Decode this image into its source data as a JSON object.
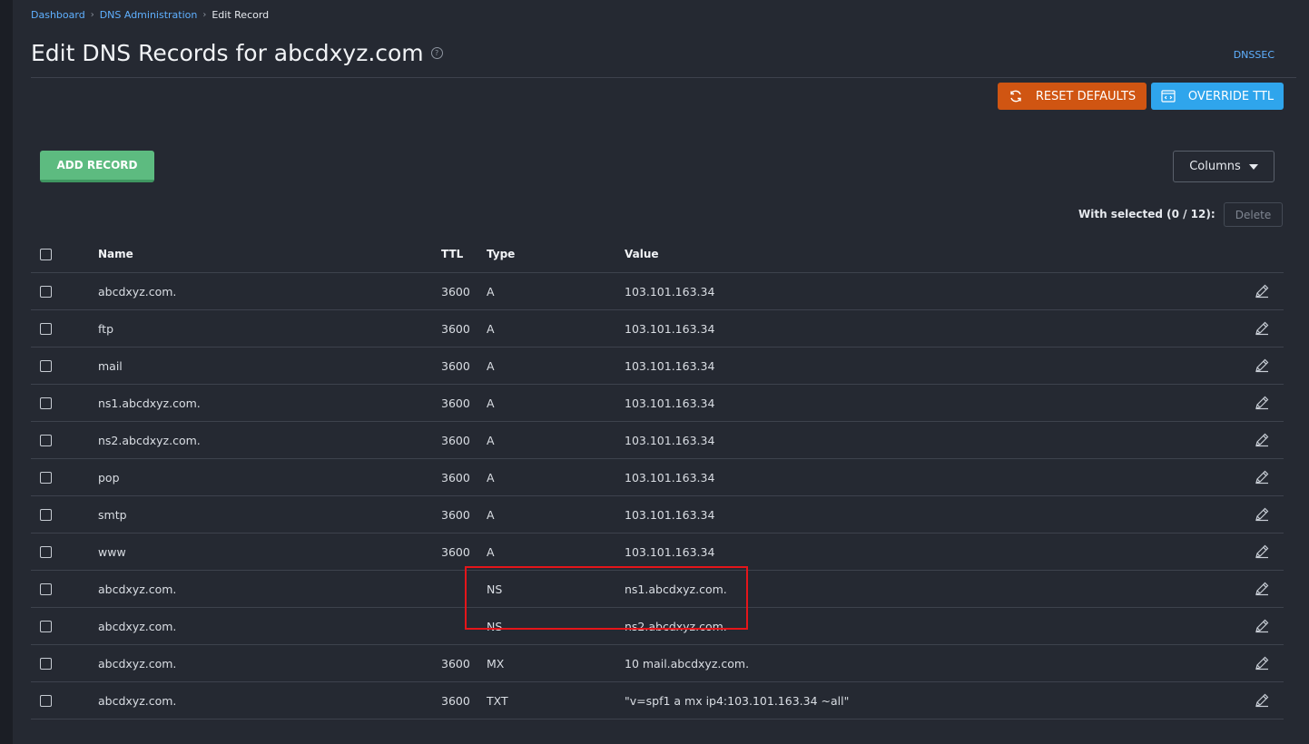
{
  "breadcrumb": {
    "items": [
      "Dashboard",
      "DNS Administration"
    ],
    "current": "Edit Record"
  },
  "page": {
    "title": "Edit DNS Records for abcdxyz.com",
    "dnssec_link": "DNSSEC"
  },
  "toolbar": {
    "reset_label": "RESET DEFAULTS",
    "override_label": "OVERRIDE TTL",
    "add_label": "ADD RECORD",
    "columns_label": "Columns",
    "with_selected": "With selected (0 / 12):",
    "delete_label": "Delete"
  },
  "colors": {
    "reset": "#d05512",
    "override": "#2fa5ec",
    "add": "#5dbb80",
    "highlight": "#e5151a",
    "link": "#5fb0ff"
  },
  "table": {
    "headers": {
      "name": "Name",
      "ttl": "TTL",
      "type": "Type",
      "value": "Value"
    },
    "rows": [
      {
        "name": "abcdxyz.com.",
        "ttl": "3600",
        "type": "A",
        "value": "103.101.163.34"
      },
      {
        "name": "ftp",
        "ttl": "3600",
        "type": "A",
        "value": "103.101.163.34"
      },
      {
        "name": "mail",
        "ttl": "3600",
        "type": "A",
        "value": "103.101.163.34"
      },
      {
        "name": "ns1.abcdxyz.com.",
        "ttl": "3600",
        "type": "A",
        "value": "103.101.163.34"
      },
      {
        "name": "ns2.abcdxyz.com.",
        "ttl": "3600",
        "type": "A",
        "value": "103.101.163.34"
      },
      {
        "name": "pop",
        "ttl": "3600",
        "type": "A",
        "value": "103.101.163.34"
      },
      {
        "name": "smtp",
        "ttl": "3600",
        "type": "A",
        "value": "103.101.163.34"
      },
      {
        "name": "www",
        "ttl": "3600",
        "type": "A",
        "value": "103.101.163.34"
      },
      {
        "name": "abcdxyz.com.",
        "ttl": "",
        "type": "NS",
        "value": "ns1.abcdxyz.com."
      },
      {
        "name": "abcdxyz.com.",
        "ttl": "",
        "type": "NS",
        "value": "ns2.abcdxyz.com."
      },
      {
        "name": "abcdxyz.com.",
        "ttl": "3600",
        "type": "MX",
        "value": "10 mail.abcdxyz.com."
      },
      {
        "name": "abcdxyz.com.",
        "ttl": "3600",
        "type": "TXT",
        "value": "\"v=spf1 a mx ip4:103.101.163.34 ~all\""
      }
    ]
  }
}
